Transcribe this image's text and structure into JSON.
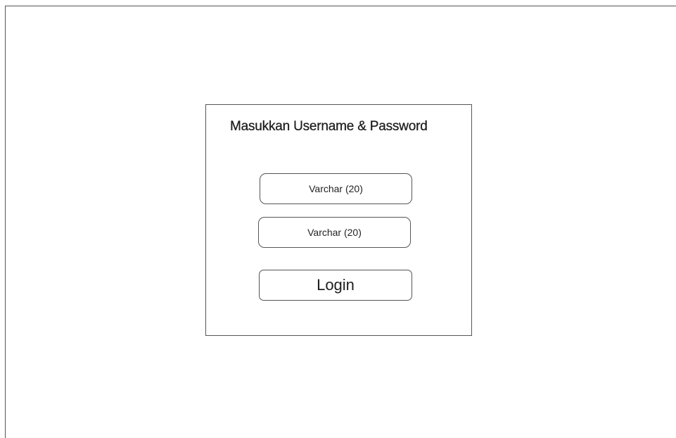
{
  "login_form": {
    "title": "Masukkan Username & Password",
    "username_field": {
      "placeholder": "Varchar (20)",
      "value": ""
    },
    "password_field": {
      "placeholder": "Varchar (20)",
      "value": ""
    },
    "login_button_label": "Login"
  },
  "colors": {
    "background": "#ffffff",
    "border": "#555555",
    "text": "#1e1e1e"
  }
}
